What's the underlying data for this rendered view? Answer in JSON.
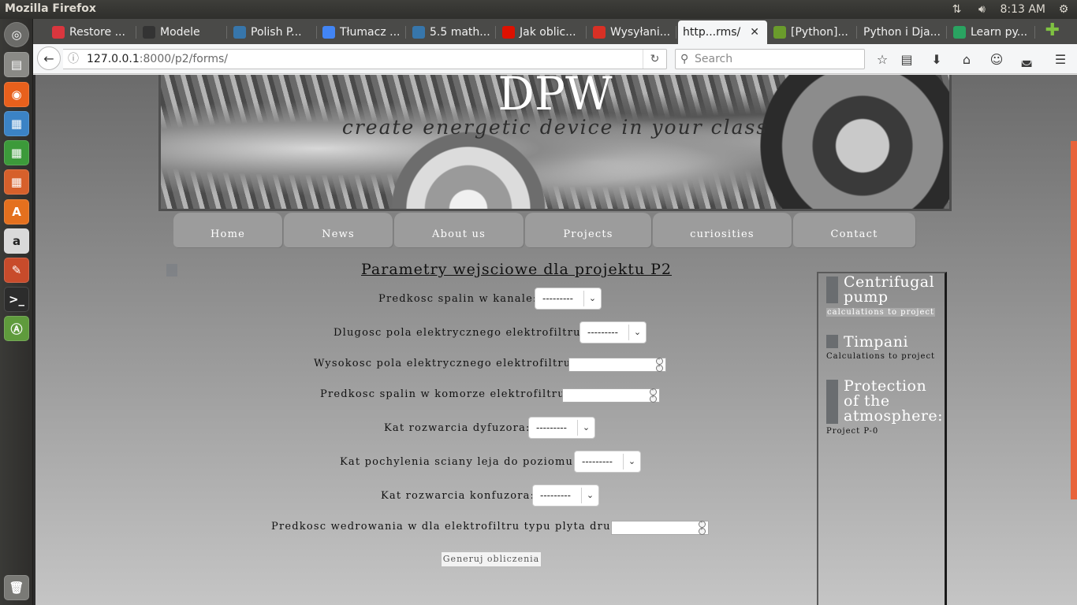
{
  "system": {
    "app_title": "Mozilla Firefox",
    "clock": "8:13 AM"
  },
  "launcher": {
    "items": [
      "dash-home",
      "files",
      "firefox",
      "writer",
      "calc",
      "impress",
      "software-center",
      "amazon",
      "system-settings",
      "terminal",
      "software-updater",
      "trash"
    ]
  },
  "browser": {
    "tabs": [
      {
        "label": "Restore ...",
        "icon": "warning-icon",
        "color": "#d9363e"
      },
      {
        "label": "Modele",
        "icon": "penguin-icon",
        "color": "#333333"
      },
      {
        "label": "Polish P...",
        "icon": "python-icon",
        "color": "#3776ab"
      },
      {
        "label": "Tłumacz ...",
        "icon": "google-translate-icon",
        "color": "#4285f4"
      },
      {
        "label": "5.5 math...",
        "icon": "python-icon",
        "color": "#3776ab"
      },
      {
        "label": "Jak oblic...",
        "icon": "wolfram-icon",
        "color": "#dd1100"
      },
      {
        "label": "Wysyłani...",
        "icon": "gmail-icon",
        "color": "#d93025"
      },
      {
        "label": "http...rms/",
        "icon": "",
        "color": "",
        "active": true
      },
      {
        "label": "[Python]...",
        "icon": "leaf-icon",
        "color": "#6a9b2c"
      },
      {
        "label": "Python i Dja...",
        "icon": "",
        "color": ""
      },
      {
        "label": "Learn py...",
        "icon": "x-icon",
        "color": "#2aa361"
      }
    ],
    "url_host": "127.0.0.1",
    "url_path": ":8000/p2/forms/",
    "search_placeholder": "Search"
  },
  "site": {
    "title": "DPW",
    "tagline": "create energetic device in your class",
    "menu": [
      "Home",
      "News",
      "About us",
      "Projects",
      "curiosities",
      "Contact"
    ]
  },
  "form": {
    "title": "Parametry wejsciowe dla projektu P2",
    "fields": [
      {
        "label": "Predkosc spalin w kanale:",
        "type": "select",
        "value": "---------"
      },
      {
        "label": "Dlugosc pola elektrycznego elektrofiltru:",
        "type": "select",
        "value": "---------"
      },
      {
        "label": "Wysokosc pola elektrycznego elektrofiltru:",
        "type": "number",
        "value": ""
      },
      {
        "label": "Predkosc spalin w komorze elektrofiltru:",
        "type": "number",
        "value": ""
      },
      {
        "label": "Kat rozwarcia dyfuzora:",
        "type": "select",
        "value": "---------"
      },
      {
        "label": "Kat pochylenia sciany leja do poziomu:",
        "type": "select",
        "value": "---------"
      },
      {
        "label": "Kat rozwarcia konfuzora:",
        "type": "select",
        "value": "---------"
      },
      {
        "label": "Predkosc wedrowania w dla elektrofiltru typu plyta drut:",
        "type": "number",
        "value": ""
      }
    ],
    "submit_label": "Generuj obliczenia"
  },
  "sidebar": {
    "entries": [
      {
        "title": "Centrifugal pump",
        "subtitle": "calculations to project"
      },
      {
        "title": "Timpani",
        "subtitle": "Calculations to project"
      },
      {
        "title": "Protection of the atmosphere:",
        "subtitle": "Project P-0"
      }
    ]
  }
}
